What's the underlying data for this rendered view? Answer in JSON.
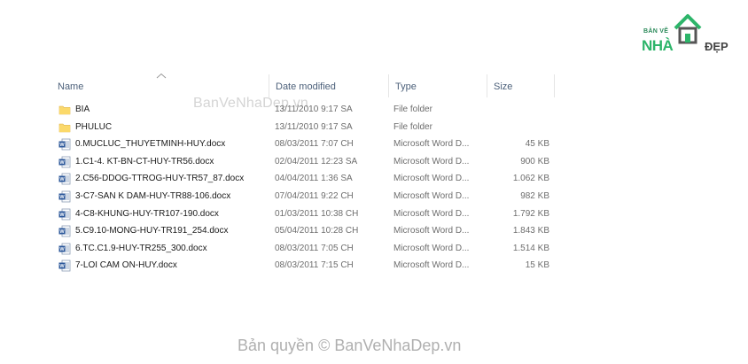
{
  "logo": {
    "line1": "BẢN VẼ",
    "brand": "NHÀ",
    "suffix": "ĐẸP"
  },
  "columns": {
    "name": "Name",
    "date": "Date modified",
    "type": "Type",
    "size": "Size"
  },
  "files": [
    {
      "icon": "folder-icon",
      "name": "BIA",
      "date": "13/11/2010 9:17 SA",
      "type": "File folder",
      "size": ""
    },
    {
      "icon": "folder-icon",
      "name": "PHULUC",
      "date": "13/11/2010 9:17 SA",
      "type": "File folder",
      "size": ""
    },
    {
      "icon": "word-doc-icon",
      "name": "0.MUCLUC_THUYETMINH-HUY.docx",
      "date": "08/03/2011 7:07 CH",
      "type": "Microsoft Word D...",
      "size": "45 KB"
    },
    {
      "icon": "word-doc-icon",
      "name": "1.C1-4. KT-BN-CT-HUY-TR56.docx",
      "date": "02/04/2011 12:23 SA",
      "type": "Microsoft Word D...",
      "size": "900 KB"
    },
    {
      "icon": "word-doc-icon",
      "name": "2.C56-DDOG-TTROG-HUY-TR57_87.docx",
      "date": "04/04/2011 1:36 SA",
      "type": "Microsoft Word D...",
      "size": "1.062 KB"
    },
    {
      "icon": "word-doc-icon",
      "name": "3-C7-SAN K DAM-HUY-TR88-106.docx",
      "date": "07/04/2011 9:22 CH",
      "type": "Microsoft Word D...",
      "size": "982 KB"
    },
    {
      "icon": "word-doc-icon",
      "name": "4-C8-KHUNG-HUY-TR107-190.docx",
      "date": "01/03/2011 10:38 CH",
      "type": "Microsoft Word D...",
      "size": "1.792 KB"
    },
    {
      "icon": "word-doc-icon",
      "name": "5.C9.10-MONG-HUY-TR191_254.docx",
      "date": "05/04/2011 10:28 CH",
      "type": "Microsoft Word D...",
      "size": "1.843 KB"
    },
    {
      "icon": "word-doc-icon",
      "name": "6.TC.C1.9-HUY-TR255_300.docx",
      "date": "08/03/2011 7:05 CH",
      "type": "Microsoft Word D...",
      "size": "1.514 KB"
    },
    {
      "icon": "word-doc-icon",
      "name": "7-LOI CAM ON-HUY.docx",
      "date": "08/03/2011 7:15 CH",
      "type": "Microsoft Word D...",
      "size": "15 KB"
    }
  ],
  "watermark_top": "BanVeNhaDep.vn",
  "watermark_bottom": "Bản quyền © BanVeNhaDep.vn"
}
